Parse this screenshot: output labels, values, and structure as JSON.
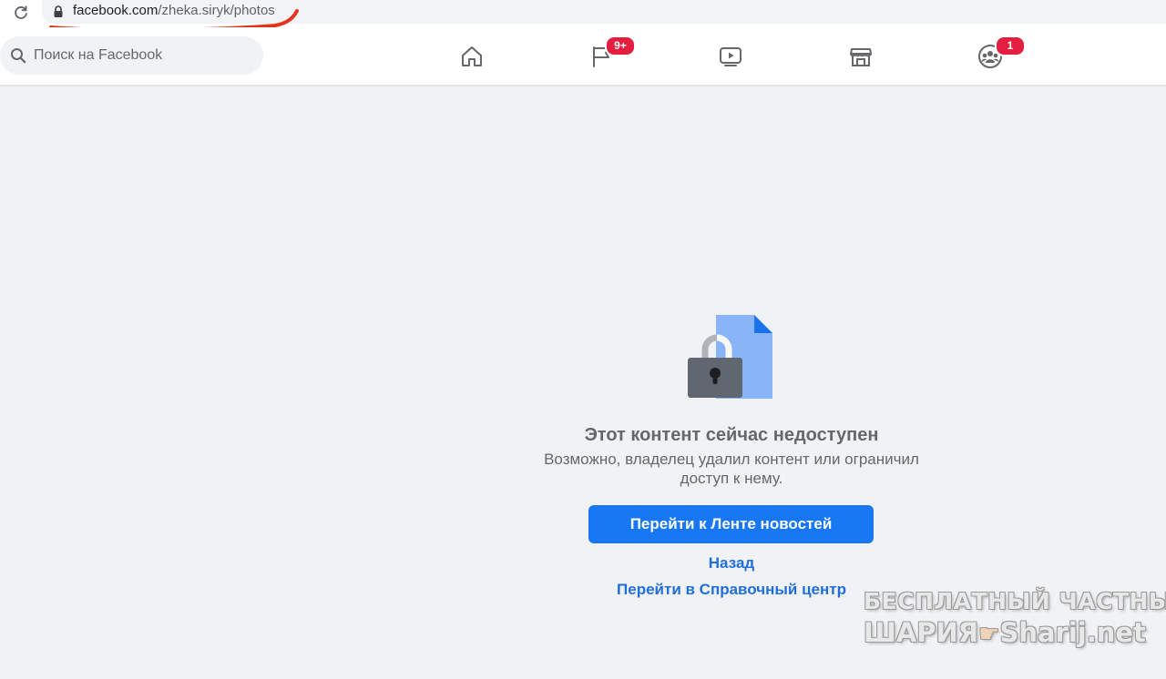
{
  "browser": {
    "url_domain": "facebook.com",
    "url_path": "/zheka.siryk/photos"
  },
  "nav": {
    "search_placeholder": "Поиск на Facebook",
    "tabs": [
      {
        "icon": "home-icon",
        "badge": ""
      },
      {
        "icon": "flag-icon",
        "badge": "9+"
      },
      {
        "icon": "watch-icon",
        "badge": ""
      },
      {
        "icon": "marketplace-icon",
        "badge": ""
      },
      {
        "icon": "groups-icon",
        "badge": "1"
      }
    ],
    "flag_badge": "9+",
    "groups_badge": "1"
  },
  "content": {
    "title": "Этот контент сейчас недоступен",
    "subtitle": "Возможно, владелец удалил контент или ограничил доступ к нему.",
    "primary_button": "Перейти к Ленте новостей",
    "back_link": "Назад",
    "help_link": "Перейти в Справочный центр"
  },
  "watermark": {
    "line1": "БЕСПЛАТНЫЙ ЧАСТНЫЙ",
    "line2_left": "ШАРИЯ",
    "line2_right": "Sharij.net"
  },
  "colors": {
    "accent": "#1877f2",
    "link": "#216fdb",
    "badge": "#e41e3f",
    "background": "#f0f2f5",
    "annotation": "#e0341c"
  }
}
